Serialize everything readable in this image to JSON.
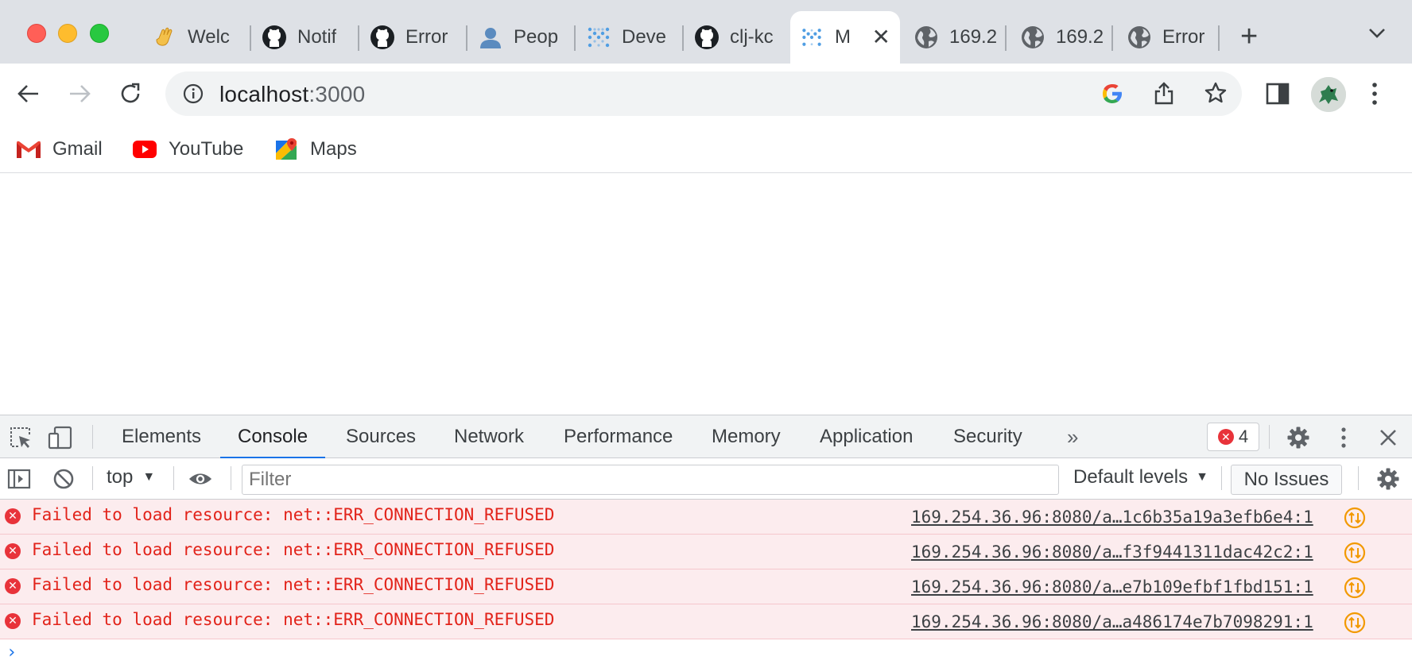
{
  "colors": {
    "accent": "#1a73e8",
    "error": "#e8333a",
    "error_text": "#e2231a",
    "error_bg": "#fcecee",
    "warning_network": "#f29900"
  },
  "browser": {
    "tabs": [
      {
        "label": "Welc",
        "icon": "waving-hand-icon"
      },
      {
        "label": "Notif",
        "icon": "github-icon"
      },
      {
        "label": "Error",
        "icon": "github-icon"
      },
      {
        "label": "Peop",
        "icon": "person-icon"
      },
      {
        "label": "Deve",
        "icon": "metabase-icon"
      },
      {
        "label": "clj-kc",
        "icon": "github-icon"
      },
      {
        "label": "M",
        "icon": "metabase-icon",
        "active": true
      },
      {
        "label": "169.2",
        "icon": "globe-icon"
      },
      {
        "label": "169.2",
        "icon": "globe-icon"
      },
      {
        "label": "Error",
        "icon": "globe-icon"
      }
    ],
    "new_tab_label": "+",
    "close_tab_label": "✕",
    "address": {
      "host": "localhost",
      "port": ":3000"
    },
    "bookmarks": [
      {
        "label": "Gmail",
        "icon": "gmail-icon"
      },
      {
        "label": "YouTube",
        "icon": "youtube-icon"
      },
      {
        "label": "Maps",
        "icon": "maps-icon"
      }
    ]
  },
  "devtools": {
    "tabs": [
      "Elements",
      "Console",
      "Sources",
      "Network",
      "Performance",
      "Memory",
      "Application",
      "Security"
    ],
    "active_tab": "Console",
    "more_tabs_label": "»",
    "error_count": "4",
    "context": "top",
    "filter_placeholder": "Filter",
    "levels": "Default levels",
    "issues": "No Issues",
    "messages": [
      {
        "text": "Failed to load resource: net::ERR_CONNECTION_REFUSED",
        "source": "169.254.36.96:8080/a…1c6b35a19a3efb6e4:1"
      },
      {
        "text": "Failed to load resource: net::ERR_CONNECTION_REFUSED",
        "source": "169.254.36.96:8080/a…f3f9441311dac42c2:1"
      },
      {
        "text": "Failed to load resource: net::ERR_CONNECTION_REFUSED",
        "source": "169.254.36.96:8080/a…e7b109efbf1fbd151:1"
      },
      {
        "text": "Failed to load resource: net::ERR_CONNECTION_REFUSED",
        "source": "169.254.36.96:8080/a…a486174e7b7098291:1"
      }
    ],
    "prompt_glyph": "›"
  }
}
